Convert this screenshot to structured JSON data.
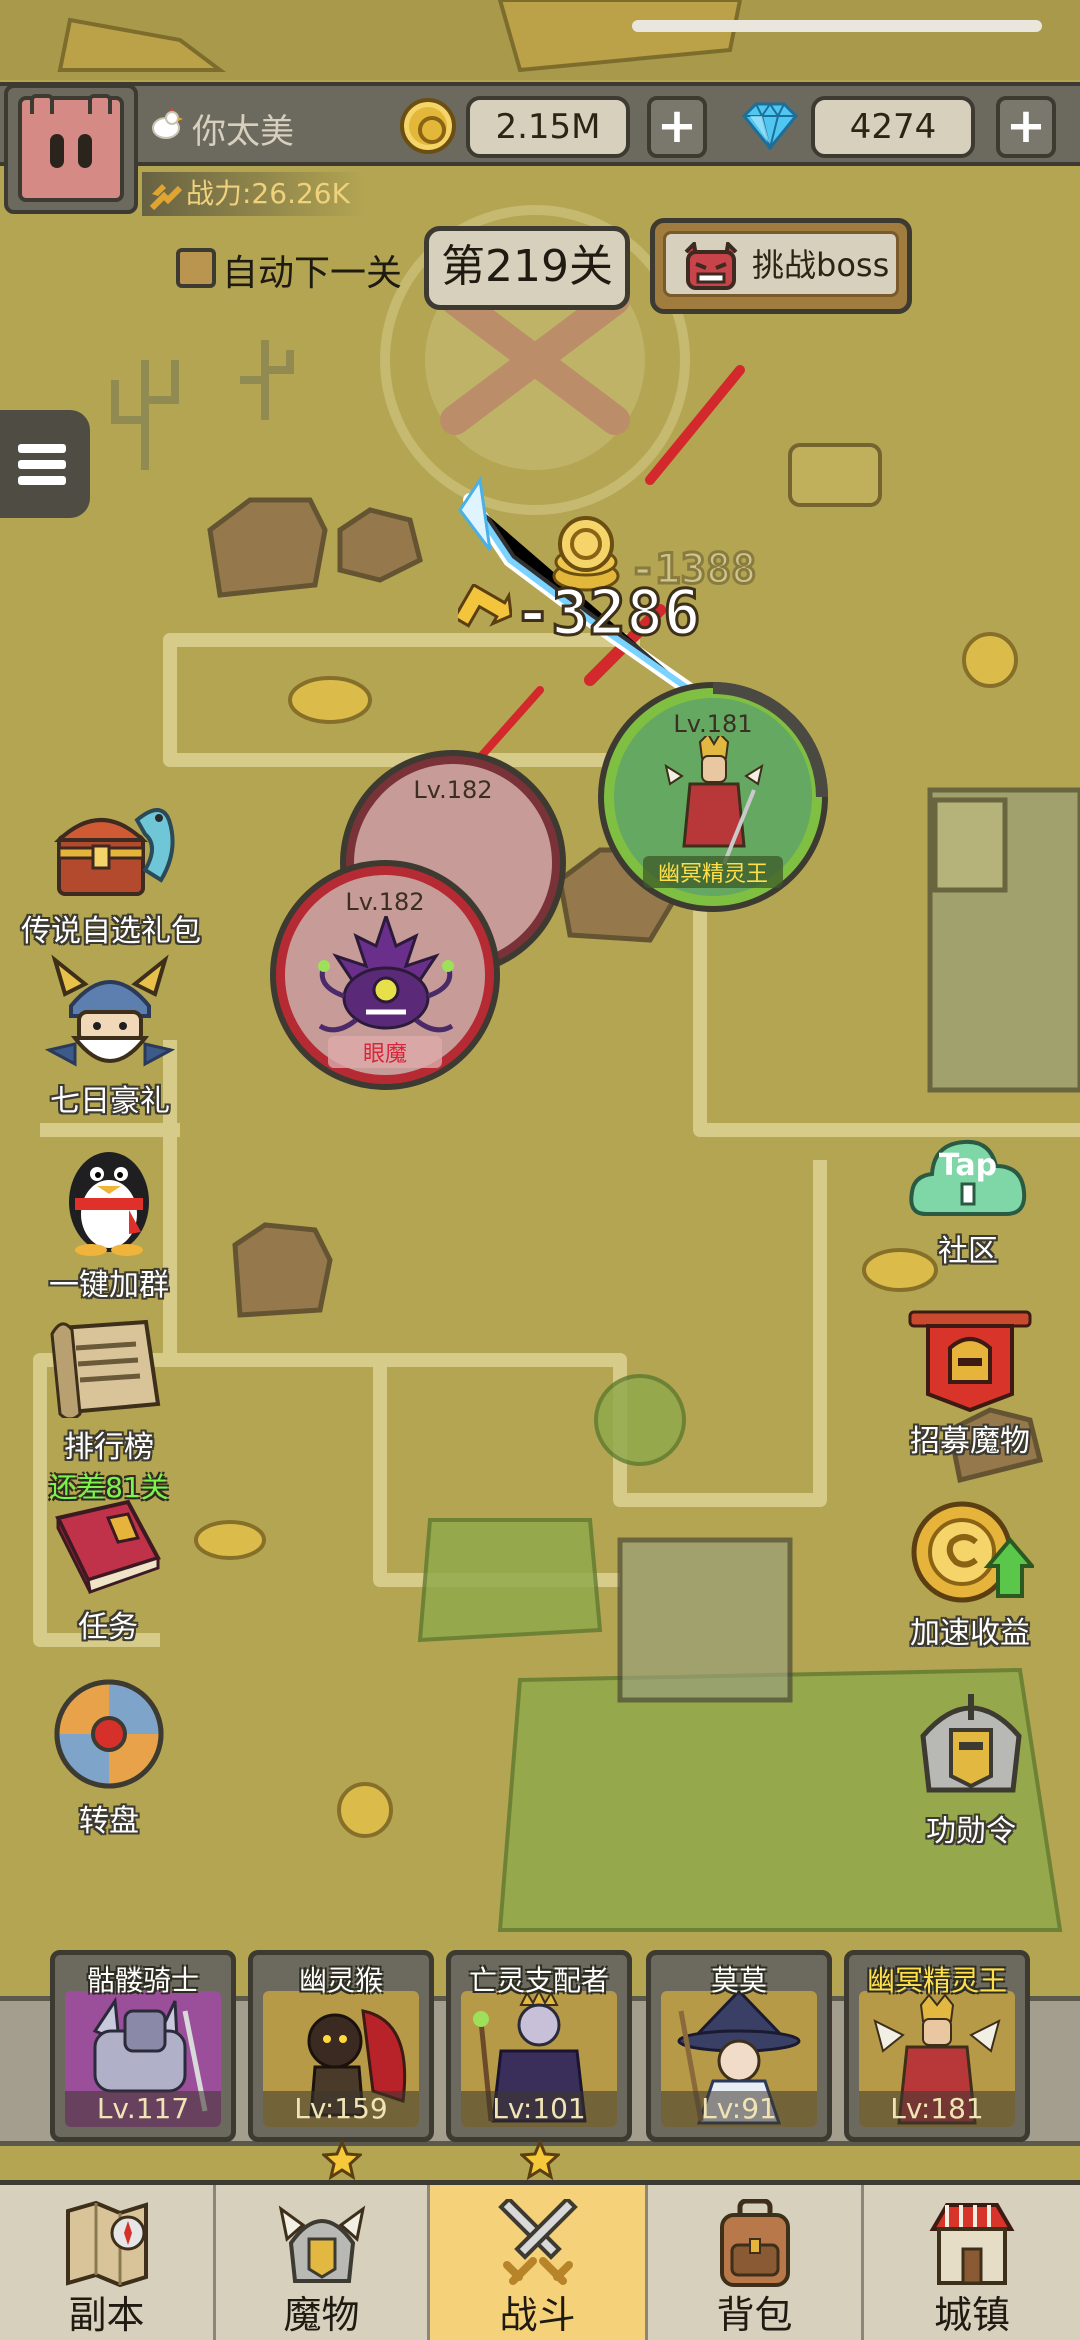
{
  "player": {
    "name": "你太美",
    "power": "战力:26.26K"
  },
  "resources": {
    "gold": "2.15M",
    "gems": "4274",
    "plus": "+"
  },
  "stage": {
    "auto_next_label": "自动下一关",
    "current": "第219关",
    "boss_button": "挑战boss"
  },
  "battle": {
    "damage_main": "-3286",
    "damage_faded": "-1388",
    "ally": {
      "level": "Lv.181",
      "name": "幽冥精灵王"
    },
    "enemies": [
      {
        "level": "Lv.182",
        "name": ""
      },
      {
        "level": "Lv.182",
        "name": "眼魔"
      }
    ]
  },
  "left_menu": [
    {
      "label": "传说自选礼包",
      "icon": "treasure-chest-dragon-icon"
    },
    {
      "label": "七日豪礼",
      "icon": "viking-warrior-icon"
    },
    {
      "label": "一键加群",
      "icon": "penguin-icon"
    },
    {
      "label": "排行榜",
      "sublabel": "还差81关",
      "icon": "scroll-ranking-icon"
    },
    {
      "label": "任务",
      "icon": "quest-book-icon"
    },
    {
      "label": "转盘",
      "icon": "wheel-icon"
    }
  ],
  "right_menu": [
    {
      "label": "社区",
      "badge": "Tap",
      "icon": "taptap-cloud-icon"
    },
    {
      "label": "招募魔物",
      "icon": "recruit-banner-icon"
    },
    {
      "label": "加速收益",
      "icon": "coin-boost-icon"
    },
    {
      "label": "功勋令",
      "icon": "knight-helmet-icon"
    }
  ],
  "team": [
    {
      "name": "骷髅骑士",
      "level": "Lv.117",
      "color": "#9b4f9a",
      "star": false,
      "gold_name": false
    },
    {
      "name": "幽灵猴",
      "level": "Lv:159",
      "color": "#b79a47",
      "star": true,
      "gold_name": false
    },
    {
      "name": "亡灵支配者",
      "level": "Lv:101",
      "color": "#b79a47",
      "star": true,
      "gold_name": false
    },
    {
      "name": "莫莫",
      "level": "Lv:91",
      "color": "#b79a47",
      "star": false,
      "gold_name": false
    },
    {
      "name": "幽冥精灵王",
      "level": "Lv:181",
      "color": "#b79a47",
      "star": false,
      "gold_name": true
    }
  ],
  "nav": [
    {
      "label": "副本",
      "icon": "map-compass-icon",
      "active": false
    },
    {
      "label": "魔物",
      "icon": "helmet-icon",
      "active": false
    },
    {
      "label": "战斗",
      "icon": "crossed-swords-icon",
      "active": true
    },
    {
      "label": "背包",
      "icon": "backpack-icon",
      "active": false
    },
    {
      "label": "城镇",
      "icon": "house-icon",
      "active": false
    }
  ],
  "colors": {
    "map": "#b3a552",
    "panel": "#6c6a5f",
    "outline": "#3d3a31",
    "ally_ring": "#7fbf42",
    "enemy_ring": "#c1373a",
    "nav_active": "#f5d27a"
  }
}
